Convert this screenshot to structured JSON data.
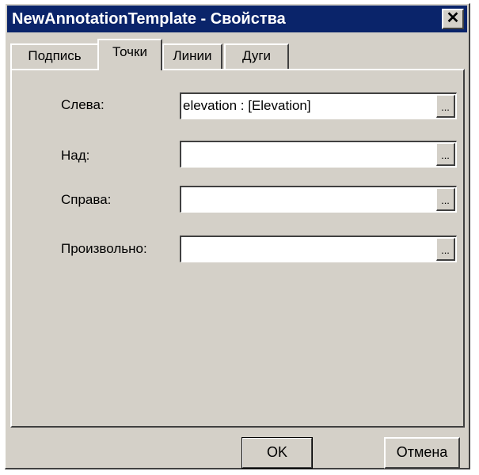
{
  "window": {
    "title": "NewAnnotationTemplate - Свойства",
    "close_glyph": "✕"
  },
  "tabs": [
    {
      "label": "Подпись",
      "active": false
    },
    {
      "label": "Точки",
      "active": true
    },
    {
      "label": "Линии",
      "active": false
    },
    {
      "label": "Дуги",
      "active": false
    }
  ],
  "fields": {
    "left": {
      "label": "Слева:",
      "value": "elevation : [Elevation]"
    },
    "above": {
      "label": "Над:",
      "value": ""
    },
    "right": {
      "label": "Справа:",
      "value": ""
    },
    "custom": {
      "label": "Произвольно:",
      "value": ""
    },
    "browse_label": "..."
  },
  "buttons": {
    "ok": "OK",
    "cancel": "Отмена"
  },
  "colors": {
    "titlebar": "#0a246a",
    "face": "#d4d0c8"
  }
}
